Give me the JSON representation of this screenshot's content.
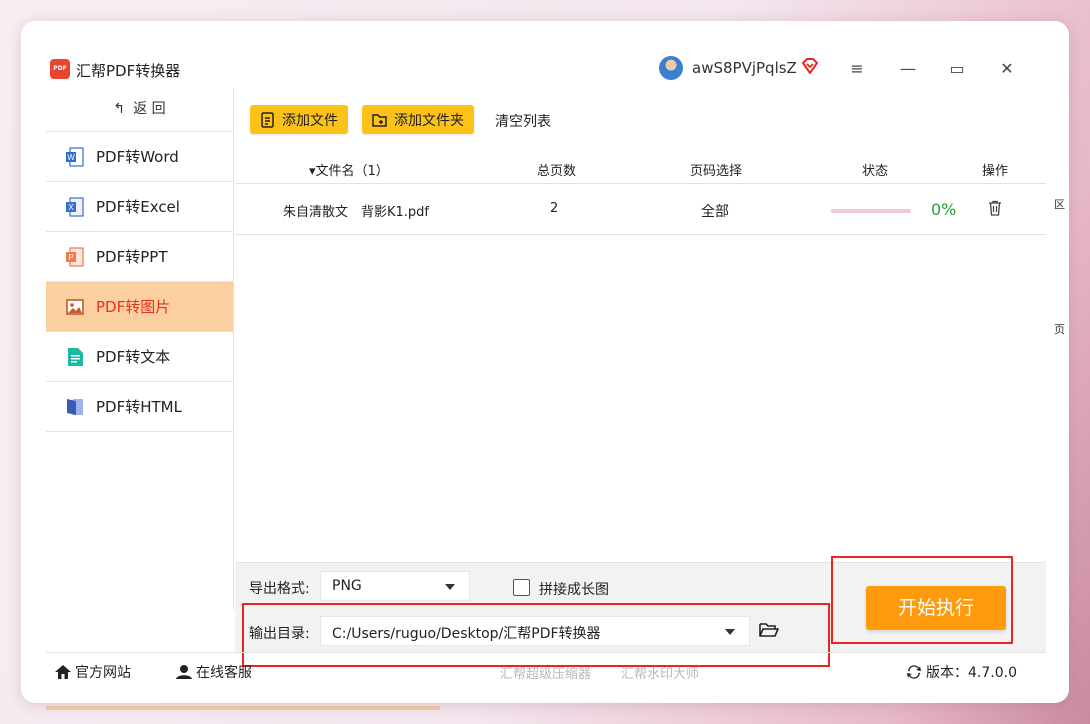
{
  "window": {
    "app_logo_text": "PDF",
    "title": "汇帮PDF转换器",
    "username": "awS8PVjPqlsZ",
    "menu_glyph": "≡",
    "minimize_glyph": "—",
    "maximize_glyph": "▭",
    "close_glyph": "✕"
  },
  "sidebar": {
    "back_arrow": "↰",
    "back_label": "返 回",
    "items": [
      {
        "label": "PDF转Word",
        "icon": "word-icon",
        "color": "#2b6fd6"
      },
      {
        "label": "PDF转Excel",
        "icon": "excel-icon",
        "color": "#3a6fd0"
      },
      {
        "label": "PDF转PPT",
        "icon": "ppt-icon",
        "color": "#f07a4a"
      },
      {
        "label": "PDF转图片",
        "icon": "image-icon",
        "color": "#e8442f",
        "active": true
      },
      {
        "label": "PDF转文本",
        "icon": "text-icon",
        "color": "#1ab9a3"
      },
      {
        "label": "PDF转HTML",
        "icon": "html-icon",
        "color": "#3a5ab8"
      }
    ]
  },
  "toolbar": {
    "add_file": "添加文件",
    "add_folder": "添加文件夹",
    "clear_list": "清空列表"
  },
  "table": {
    "headers": {
      "filename": "▾文件名（1）",
      "pages": "总页数",
      "page_select": "页码选择",
      "status": "状态",
      "actions": "操作"
    },
    "rows": [
      {
        "filename": "朱自清散文　背影K1.pdf",
        "pages": "2",
        "page_select": "全部",
        "progress": 0,
        "progress_text": "0%"
      }
    ]
  },
  "edge_chars": [
    "区",
    "页"
  ],
  "output": {
    "format_label": "导出格式:",
    "format_value": "PNG",
    "stitch_label": "拼接成长图",
    "stitch_checked": false,
    "dir_label": "输出目录:",
    "dir_value": "C:/Users/ruguo/Desktop/汇帮PDF转换器"
  },
  "start_button": "开始执行",
  "footer": {
    "website": "官方网站",
    "support": "在线客服",
    "promo1": "汇帮超级压缩器",
    "promo2": "汇帮水印大师",
    "version": "版本：4.7.0.0"
  },
  "colors": {
    "accent": "#fcc21a",
    "start": "#ff9a0d",
    "active_nav": "#fccfa0",
    "highlight_box": "#e8271f"
  }
}
